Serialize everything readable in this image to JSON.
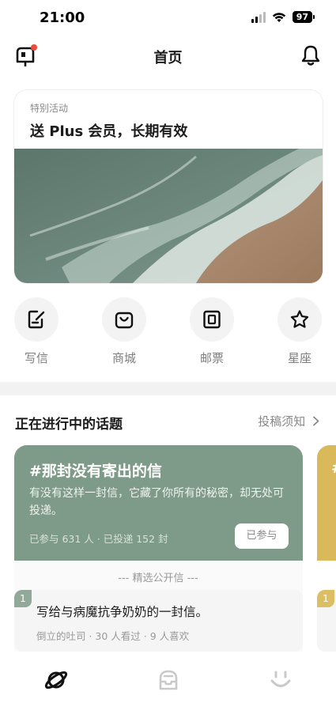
{
  "status_bar": {
    "time": "21:00",
    "battery": "97"
  },
  "nav": {
    "title": "首页"
  },
  "promo": {
    "tag": "特别活动",
    "title": "送 Plus 会员，长期有效"
  },
  "shortcuts": [
    {
      "label": "写信",
      "icon": "write-letter-icon"
    },
    {
      "label": "商城",
      "icon": "shopping-bag-icon"
    },
    {
      "label": "邮票",
      "icon": "stamp-icon"
    },
    {
      "label": "星座",
      "icon": "star-icon"
    }
  ],
  "topics": {
    "section_title": "正在进行中的话题",
    "guidelines_link": "投稿须知",
    "cards": [
      {
        "title": "#那封没有寄出的信",
        "description": "有没有这样一封信，它藏了你所有的秘密，却无处可投递。",
        "meta": "已参与 631 人 · 已投递 152 封",
        "button": "已参与",
        "color": "#7e9a88"
      },
      {
        "title": "#",
        "color": "#d9b95a"
      }
    ],
    "selected_header": "--- 精选公开信 ---",
    "letters": [
      {
        "rank": "1",
        "title": "写给与病魔抗争奶奶的一封信。",
        "meta": "倒立的吐司 · 30 人看过 · 9 人喜欢"
      },
      {
        "rank": "1"
      }
    ]
  },
  "tabbar": [
    {
      "icon": "planet-icon",
      "active": true
    },
    {
      "icon": "mailbox-tab-icon",
      "active": false
    },
    {
      "icon": "smiley-icon",
      "active": false
    }
  ]
}
